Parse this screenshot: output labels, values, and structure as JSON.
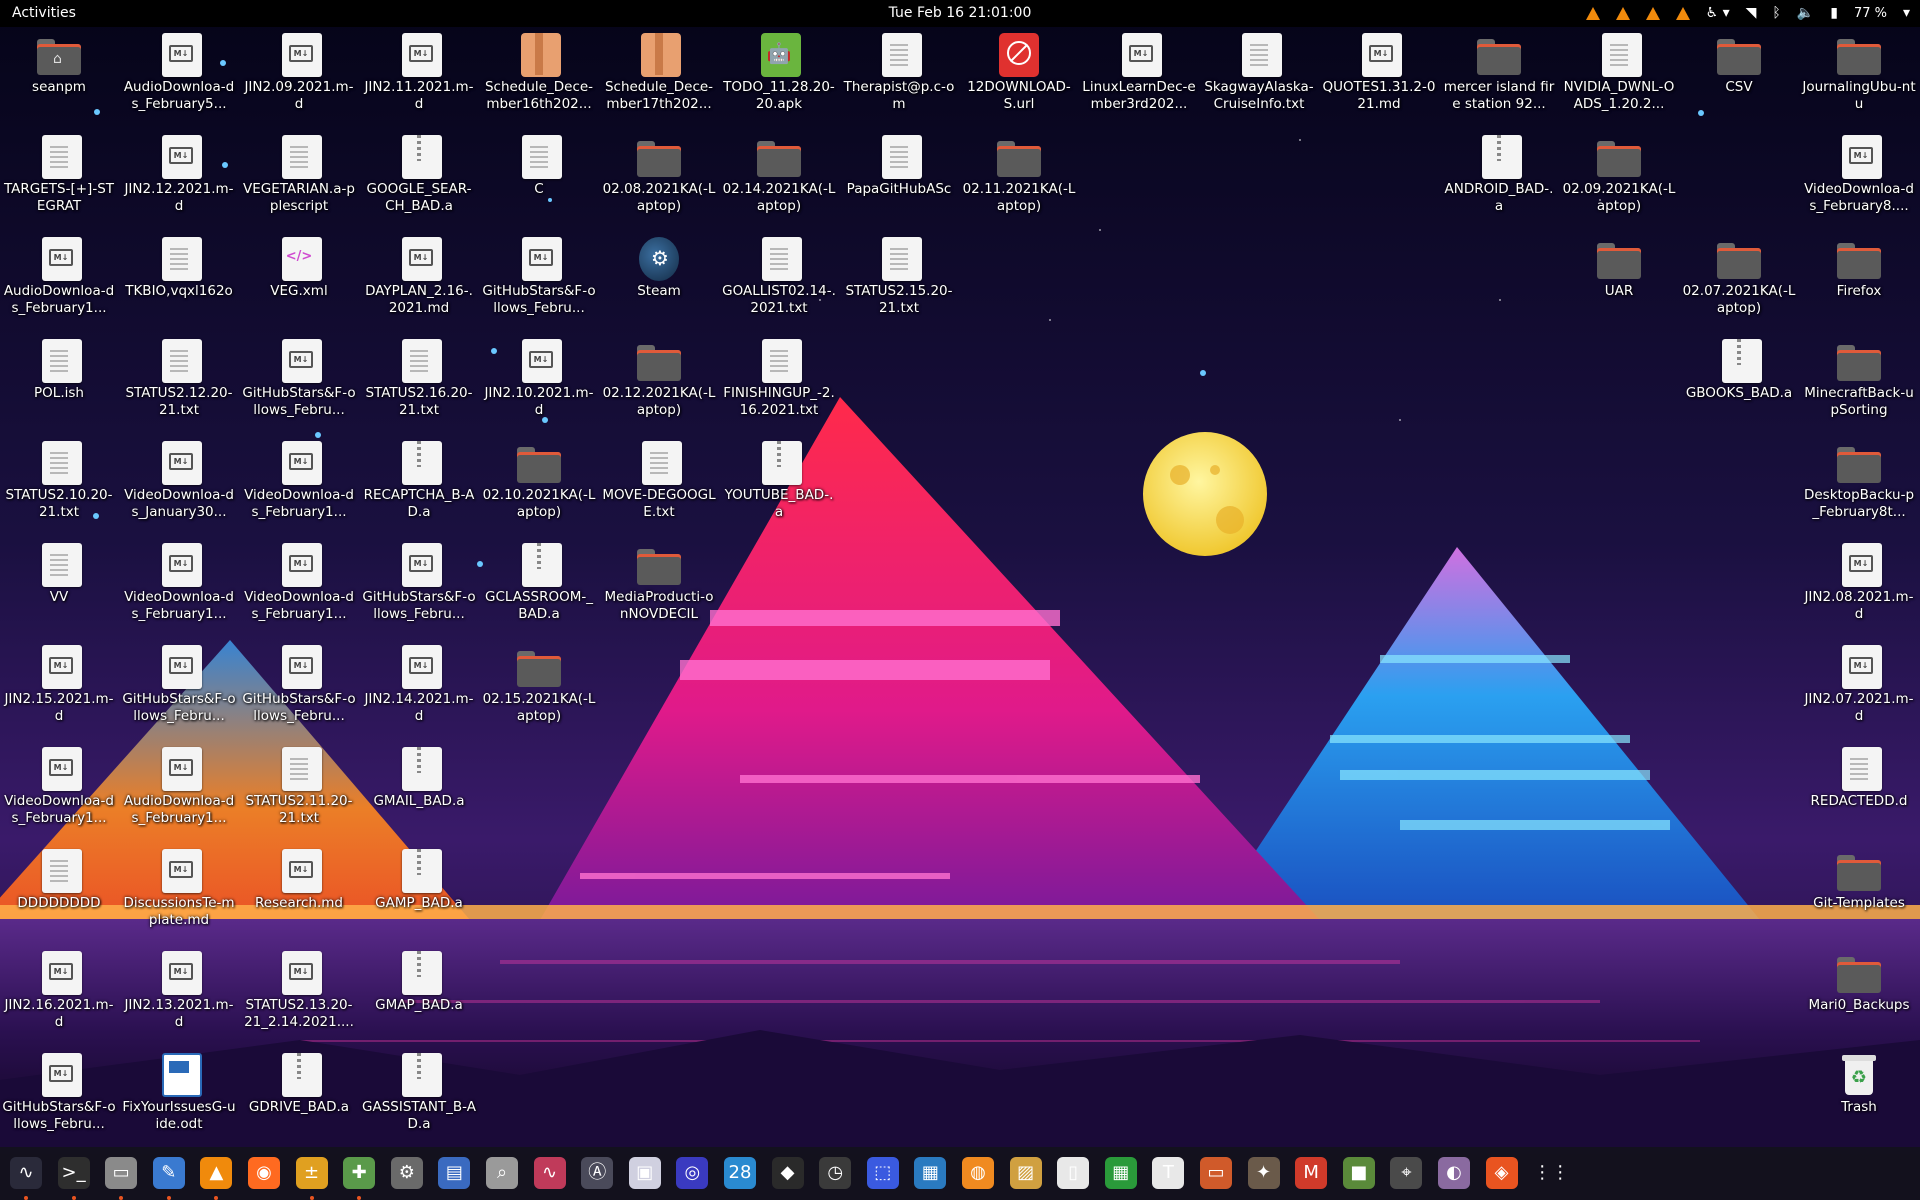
{
  "topbar": {
    "activities": "Activities",
    "clock": "Tue Feb 16  21:01:00",
    "battery": "77 %",
    "tray_icons": [
      "vlc-icon",
      "vlc-icon",
      "vlc-icon",
      "vlc-icon",
      "accessibility-icon",
      "wifi-icon",
      "bluetooth-icon",
      "volume-icon",
      "battery-icon"
    ]
  },
  "colors": {
    "accent": "#e95420",
    "folder_body": "#5a5a5a",
    "folder_stripe": "#e05a3a",
    "topbar_bg": "#000000"
  },
  "desktop": {
    "icons": [
      {
        "label": "seanpm",
        "type": "home-folder"
      },
      {
        "label": "AudioDownloa-ds_February5...",
        "type": "md"
      },
      {
        "label": "JIN2.09.2021.m-d",
        "type": "md"
      },
      {
        "label": "JIN2.11.2021.m-d",
        "type": "md"
      },
      {
        "label": "Schedule_Dece-mber16th202...",
        "type": "package"
      },
      {
        "label": "Schedule_Dece-mber17th202...",
        "type": "package"
      },
      {
        "label": "TODO_11.28.20-20.apk",
        "type": "apk"
      },
      {
        "label": "Therapist@p.c-om",
        "type": "text"
      },
      {
        "label": "12DOWNLOAD-S.url",
        "type": "url"
      },
      {
        "label": "LinuxLearnDec-ember3rd202...",
        "type": "md"
      },
      {
        "label": "SkagwayAlaska-CruiseInfo.txt",
        "type": "text"
      },
      {
        "label": "QUOTES1.31.2-021.md",
        "type": "md"
      },
      {
        "label": "mercer island fire station 92...",
        "type": "folder"
      },
      {
        "label": "NVIDIA_DWNL-OADS_1.20.2...",
        "type": "text"
      },
      {
        "label": "CSV",
        "type": "folder"
      },
      {
        "label": "JournalingUbu-ntu",
        "type": "folder"
      },
      {
        "label": "TARGETS-[+]-STEGRAT",
        "type": "text"
      },
      {
        "label": "JIN2.12.2021.m-d",
        "type": "md"
      },
      {
        "label": "VEGETARIAN.a-pplescript",
        "type": "text"
      },
      {
        "label": "GOOGLE_SEAR-CH_BAD.a",
        "type": "archive"
      },
      {
        "label": "C",
        "type": "text"
      },
      {
        "label": "02.08.2021KA(-Laptop)",
        "type": "folder"
      },
      {
        "label": "02.14.2021KA(-Laptop)",
        "type": "folder"
      },
      {
        "label": "PapaGitHubASc",
        "type": "text"
      },
      {
        "label": "02.11.2021KA(-Laptop)",
        "type": "folder"
      },
      {
        "label": "ANDROID_BAD-.a",
        "type": "archive"
      },
      {
        "label": "02.09.2021KA(-Laptop)",
        "type": "folder"
      },
      {
        "label": "VideoDownloa-ds_February8....",
        "type": "md"
      },
      {
        "label": "AudioDownloa-ds_February1...",
        "type": "md"
      },
      {
        "label": "TKBIO,vqxl162o",
        "type": "text"
      },
      {
        "label": "VEG.xml",
        "type": "xml"
      },
      {
        "label": "DAYPLAN_2.16-.2021.md",
        "type": "md"
      },
      {
        "label": "GitHubStars&F-ollows_Febru...",
        "type": "md"
      },
      {
        "label": "Steam",
        "type": "steam"
      },
      {
        "label": "GOALLIST02.14-.2021.txt",
        "type": "text"
      },
      {
        "label": "STATUS2.15.20-21.txt",
        "type": "text"
      },
      {
        "label": "UAR",
        "type": "folder"
      },
      {
        "label": "02.07.2021KA(-Laptop)",
        "type": "folder"
      },
      {
        "label": "Firefox",
        "type": "folder"
      },
      {
        "label": "POL.ish",
        "type": "text"
      },
      {
        "label": "STATUS2.12.20-21.txt",
        "type": "text"
      },
      {
        "label": "GitHubStars&F-ollows_Febru...",
        "type": "md"
      },
      {
        "label": "STATUS2.16.20-21.txt",
        "type": "text"
      },
      {
        "label": "JIN2.10.2021.m-d",
        "type": "md"
      },
      {
        "label": "02.12.2021KA(-Laptop)",
        "type": "folder"
      },
      {
        "label": "FINISHINGUP_-2.16.2021.txt",
        "type": "text"
      },
      {
        "label": "GBOOKS_BAD.a",
        "type": "archive"
      },
      {
        "label": "MinecraftBack-upSorting",
        "type": "folder"
      },
      {
        "label": "STATUS2.10.20-21.txt",
        "type": "text"
      },
      {
        "label": "VideoDownloa-ds_January30...",
        "type": "md"
      },
      {
        "label": "VideoDownloa-ds_February1...",
        "type": "md"
      },
      {
        "label": "RECAPTCHA_B-AD.a",
        "type": "archive"
      },
      {
        "label": "02.10.2021KA(-Laptop)",
        "type": "folder"
      },
      {
        "label": "MOVE-DEGOOGLE.txt",
        "type": "text"
      },
      {
        "label": "YOUTUBE_BAD-.a",
        "type": "archive"
      },
      {
        "label": "DesktopBacku-p_February8t...",
        "type": "folder"
      },
      {
        "label": "VV",
        "type": "text"
      },
      {
        "label": "VideoDownloa-ds_February1...",
        "type": "md"
      },
      {
        "label": "VideoDownloa-ds_February1...",
        "type": "md"
      },
      {
        "label": "GitHubStars&F-ollows_Febru...",
        "type": "md"
      },
      {
        "label": "GCLASSROOM-_BAD.a",
        "type": "archive"
      },
      {
        "label": "MediaProducti-onNOVDECIL",
        "type": "folder"
      },
      {
        "label": "JIN2.08.2021.m-d",
        "type": "md"
      },
      {
        "label": "JIN2.15.2021.m-d",
        "type": "md"
      },
      {
        "label": "GitHubStars&F-ollows_Febru...",
        "type": "md"
      },
      {
        "label": "GitHubStars&F-ollows_Febru...",
        "type": "md"
      },
      {
        "label": "JIN2.14.2021.m-d",
        "type": "md"
      },
      {
        "label": "02.15.2021KA(-Laptop)",
        "type": "folder"
      },
      {
        "label": "JIN2.07.2021.m-d",
        "type": "md"
      },
      {
        "label": "VideoDownloa-ds_February1...",
        "type": "md"
      },
      {
        "label": "AudioDownloa-ds_February1...",
        "type": "md"
      },
      {
        "label": "STATUS2.11.20-21.txt",
        "type": "text"
      },
      {
        "label": "GMAIL_BAD.a",
        "type": "archive"
      },
      {
        "label": "REDACTEDD.d",
        "type": "text"
      },
      {
        "label": "DDDDDDDD",
        "type": "text"
      },
      {
        "label": "DiscussionsTe-mplate.md",
        "type": "md"
      },
      {
        "label": "Research.md",
        "type": "md"
      },
      {
        "label": "GAMP_BAD.a",
        "type": "archive"
      },
      {
        "label": "Git-Templates",
        "type": "folder"
      },
      {
        "label": "JIN2.16.2021.m-d",
        "type": "md"
      },
      {
        "label": "JIN2.13.2021.m-d",
        "type": "md"
      },
      {
        "label": "STATUS2.13.20-21_2.14.2021....",
        "type": "md"
      },
      {
        "label": "GMAP_BAD.a",
        "type": "archive"
      },
      {
        "label": "Mari0_Backups",
        "type": "folder"
      },
      {
        "label": "GitHubStars&F-ollows_Febru...",
        "type": "md"
      },
      {
        "label": "FixYourIssuesG-uide.odt",
        "type": "odt"
      },
      {
        "label": "GDRIVE_BAD.a",
        "type": "archive"
      },
      {
        "label": "GASSISTANT_B-AD.a",
        "type": "archive"
      },
      {
        "label": "Trash",
        "type": "trash"
      }
    ]
  },
  "dock": {
    "apps": [
      {
        "icon": "system-monitor-icon",
        "running": true
      },
      {
        "icon": "terminal-icon",
        "running": true
      },
      {
        "icon": "files-icon",
        "running": true
      },
      {
        "icon": "text-editor-icon",
        "running": true
      },
      {
        "icon": "vlc-icon",
        "running": true
      },
      {
        "icon": "firefox-icon",
        "running": false
      },
      {
        "icon": "calculator-icon",
        "running": true
      },
      {
        "icon": "puzzle-icon",
        "running": true
      },
      {
        "icon": "settings-icon",
        "running": false
      },
      {
        "icon": "document-viewer-icon",
        "running": false
      },
      {
        "icon": "search-icon",
        "running": false
      },
      {
        "icon": "audio-wave-icon",
        "running": false
      },
      {
        "icon": "software-icon",
        "running": false
      },
      {
        "icon": "image-viewer-icon",
        "running": false
      },
      {
        "icon": "scanner-icon",
        "running": false
      },
      {
        "icon": "calendar-icon",
        "label": "28",
        "running": false
      },
      {
        "icon": "inkscape-icon",
        "running": false
      },
      {
        "icon": "clock-icon",
        "running": false
      },
      {
        "icon": "screenshot-icon",
        "running": false
      },
      {
        "icon": "virtualbox-icon",
        "running": false
      },
      {
        "icon": "blender-icon",
        "running": false
      },
      {
        "icon": "photo-icon",
        "running": false
      },
      {
        "icon": "document-icon",
        "running": false
      },
      {
        "icon": "spreadsheet-icon",
        "running": false
      },
      {
        "icon": "typora-icon",
        "running": false
      },
      {
        "icon": "presentation-icon",
        "running": false
      },
      {
        "icon": "gimp-icon",
        "running": false
      },
      {
        "icon": "mario-icon",
        "running": false
      },
      {
        "icon": "minecraft-icon",
        "running": false
      },
      {
        "icon": "maps-icon",
        "running": false
      },
      {
        "icon": "tweaks-icon",
        "running": false
      },
      {
        "icon": "ubuntu-software-icon",
        "running": false
      },
      {
        "icon": "show-apps-icon",
        "running": false
      }
    ]
  }
}
